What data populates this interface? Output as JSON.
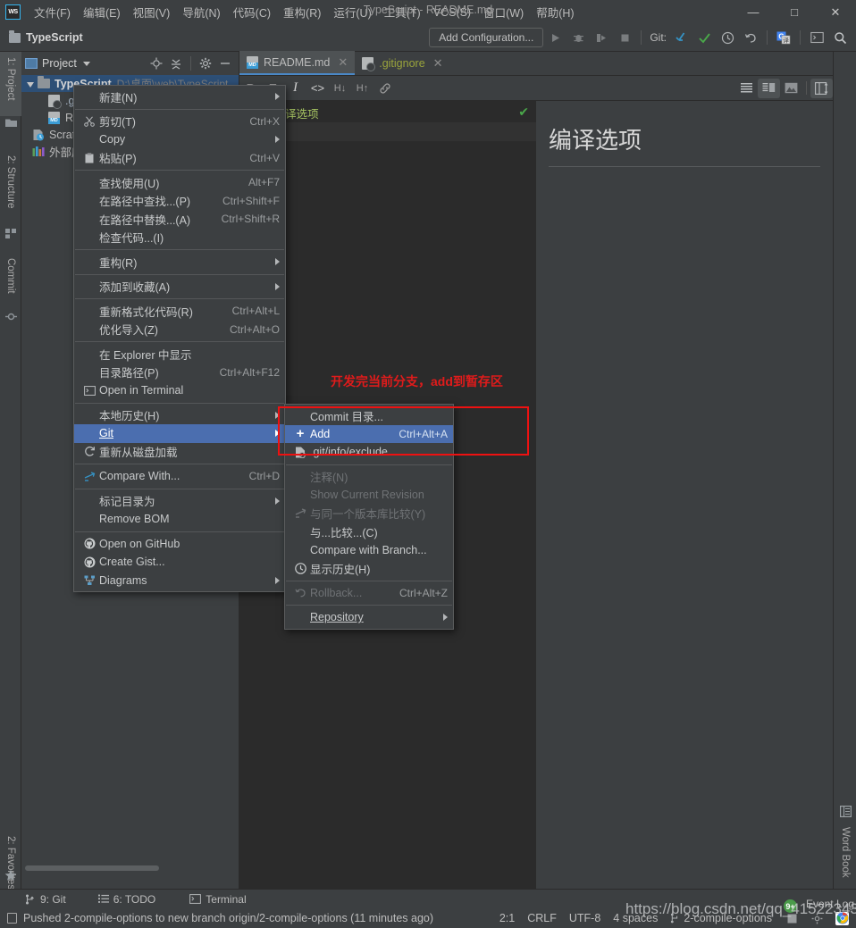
{
  "window": {
    "title": "TypeScript - README.md",
    "minimize": "—",
    "maximize": "□",
    "close": "✕"
  },
  "menubar": {
    "logo": "WS",
    "items": [
      {
        "label": "文件(F)"
      },
      {
        "label": "编辑(E)"
      },
      {
        "label": "视图(V)"
      },
      {
        "label": "导航(N)"
      },
      {
        "label": "代码(C)"
      },
      {
        "label": "重构(R)"
      },
      {
        "label": "运行(U)"
      },
      {
        "label": "工具(T)"
      },
      {
        "label": "VCS(S)"
      },
      {
        "label": "窗口(W)"
      },
      {
        "label": "帮助(H)"
      }
    ]
  },
  "toolbar": {
    "project_name": "TypeScript",
    "run_config": "Add Configuration...",
    "git_label": "Git:",
    "icons": [
      "run-icon",
      "debug-icon",
      "coverage-icon",
      "stop-icon",
      "git-update-icon",
      "git-commit-icon",
      "git-history-icon",
      "git-rollback-icon",
      "translate-icon",
      "terminal-icon",
      "search-everywhere-icon"
    ]
  },
  "left_rail": {
    "items": [
      {
        "label": "1: Project",
        "icon": "project-folder-icon",
        "selected": true
      },
      {
        "label": "2: Structure",
        "icon": "structure-icon",
        "selected": false
      },
      {
        "label": "Commit",
        "icon": "commit-icon",
        "selected": false
      },
      {
        "label": "2: Favorites",
        "icon": "star-icon",
        "selected": false
      }
    ]
  },
  "right_rail": {
    "items": [
      {
        "label": "Word Book",
        "icon": "word-book-icon"
      }
    ]
  },
  "project_panel": {
    "header": "Project",
    "header_icons": [
      "locate-icon",
      "collapse-all-icon",
      "settings-gear-icon",
      "hide-icon"
    ],
    "tree": [
      {
        "name": "TypeScript",
        "path": "D:\\桌面\\web\\TypeScript",
        "selected": true,
        "icon": "folder-icon",
        "expanded": true
      },
      {
        "name": ".gitignore",
        "icon": "gitignore-icon"
      },
      {
        "name": "README.md",
        "icon": "markdown-icon"
      },
      {
        "name": "Scratches and Consoles",
        "icon": "scratches-icon"
      },
      {
        "name": "外部库",
        "icon": "external-libraries-icon"
      }
    ]
  },
  "editor_tabs": [
    {
      "label": "README.md",
      "icon": "markdown-icon",
      "active": true,
      "close": "✕"
    },
    {
      "label": ".gitignore",
      "icon": "gitignore-icon",
      "active": false,
      "close": "✕"
    }
  ],
  "editor_toolbar": {
    "icons": [
      "bold-icon",
      "strikethrough-icon",
      "italic-icon",
      "code-icon",
      "header-down-icon",
      "header-up-icon",
      "link-icon"
    ],
    "right_icons": [
      "show-editor-only-icon",
      "show-editor-and-preview-icon",
      "show-preview-only-icon",
      "split-layout-icon"
    ]
  },
  "editor": {
    "line1_marker": "##",
    "line1_text": "编译选项",
    "inspection_ok": "✔",
    "annotation": "开发完当前分支，add到暂存区"
  },
  "preview": {
    "heading": "编译选项"
  },
  "context_menu": {
    "items": [
      {
        "label": "新建(N)",
        "icon": "",
        "shortcut": "",
        "arrow": true
      },
      {
        "sep": true
      },
      {
        "label": "剪切(T)",
        "icon": "cut-icon",
        "shortcut": "Ctrl+X"
      },
      {
        "label": "Copy",
        "icon": "",
        "shortcut": "",
        "arrow": true
      },
      {
        "label": "粘贴(P)",
        "icon": "paste-icon",
        "shortcut": "Ctrl+V"
      },
      {
        "sep": true
      },
      {
        "label": "查找使用(U)",
        "icon": "",
        "shortcut": "Alt+F7"
      },
      {
        "label": "在路径中查找...(P)",
        "icon": "",
        "shortcut": "Ctrl+Shift+F"
      },
      {
        "label": "在路径中替换...(A)",
        "icon": "",
        "shortcut": "Ctrl+Shift+R"
      },
      {
        "label": "检查代码...(I)",
        "icon": "",
        "shortcut": ""
      },
      {
        "sep": true
      },
      {
        "label": "重构(R)",
        "icon": "",
        "shortcut": "",
        "arrow": true
      },
      {
        "sep": true
      },
      {
        "label": "添加到收藏(A)",
        "icon": "",
        "shortcut": "",
        "arrow": true
      },
      {
        "sep": true
      },
      {
        "label": "重新格式化代码(R)",
        "icon": "",
        "shortcut": "Ctrl+Alt+L"
      },
      {
        "label": "优化导入(Z)",
        "icon": "",
        "shortcut": "Ctrl+Alt+O"
      },
      {
        "sep": true
      },
      {
        "label": "在 Explorer 中显示",
        "icon": "",
        "shortcut": ""
      },
      {
        "label": "目录路径(P)",
        "icon": "",
        "shortcut": "Ctrl+Alt+F12"
      },
      {
        "label": "Open in Terminal",
        "icon": "terminal-icon",
        "shortcut": ""
      },
      {
        "sep": true
      },
      {
        "label": "本地历史(H)",
        "icon": "",
        "shortcut": "",
        "arrow": true
      },
      {
        "label": "Git",
        "icon": "",
        "shortcut": "",
        "arrow": true,
        "selected": true
      },
      {
        "label": "重新从磁盘加载",
        "icon": "refresh-icon",
        "shortcut": ""
      },
      {
        "sep": true
      },
      {
        "label": "Compare With...",
        "icon": "compare-icon",
        "shortcut": "Ctrl+D"
      },
      {
        "sep": true
      },
      {
        "label": "标记目录为",
        "icon": "",
        "shortcut": "",
        "arrow": true
      },
      {
        "label": "Remove BOM",
        "icon": "",
        "shortcut": ""
      },
      {
        "sep": true
      },
      {
        "label": "Open on GitHub",
        "icon": "github-icon",
        "shortcut": ""
      },
      {
        "label": "Create Gist...",
        "icon": "github-icon",
        "shortcut": ""
      },
      {
        "label": "Diagrams",
        "icon": "diagrams-icon",
        "shortcut": "",
        "arrow": true
      }
    ]
  },
  "git_submenu": {
    "items": [
      {
        "label": "Commit 目录...",
        "icon": "",
        "shortcut": ""
      },
      {
        "label": "Add",
        "icon": "add-plus-icon",
        "shortcut": "Ctrl+Alt+A",
        "selected": true
      },
      {
        "label": ".git/info/exclude",
        "icon": "gitignore-icon",
        "shortcut": ""
      },
      {
        "sep": true
      },
      {
        "label": "注释(N)",
        "icon": "",
        "shortcut": "",
        "disabled": true
      },
      {
        "label": "Show Current Revision",
        "icon": "",
        "shortcut": "",
        "disabled": true
      },
      {
        "label": "与同一个版本库比较(Y)",
        "icon": "compare-icon",
        "shortcut": "",
        "disabled": true
      },
      {
        "label": "与...比较...(C)",
        "icon": "",
        "shortcut": ""
      },
      {
        "label": "Compare with Branch...",
        "icon": "",
        "shortcut": ""
      },
      {
        "label": "显示历史(H)",
        "icon": "history-clock-icon",
        "shortcut": ""
      },
      {
        "sep": true
      },
      {
        "label": "Rollback...",
        "icon": "rollback-icon",
        "shortcut": "Ctrl+Alt+Z",
        "disabled": true
      },
      {
        "sep": true
      },
      {
        "label": "Repository",
        "icon": "",
        "shortcut": "",
        "arrow": true
      }
    ]
  },
  "bottom_bar": {
    "items": [
      {
        "label": "9: Git",
        "icon": "git-branch-icon"
      },
      {
        "label": "6: TODO",
        "icon": "todo-list-icon"
      },
      {
        "label": "Terminal",
        "icon": "terminal-icon"
      }
    ]
  },
  "status_bar": {
    "message": "Pushed 2-compile-options to new branch origin/2-compile-options (11 minutes ago)",
    "caret": "2:1",
    "line_sep": "CRLF",
    "encoding": "UTF-8",
    "indent": "4 spaces",
    "branch": "2-compile-options",
    "event_log": "Event Log",
    "event_count": "9+"
  },
  "watermark": {
    "text": "https://blog.csdn.net/qq_41522343"
  },
  "colors": {
    "bg": "#3c3f41",
    "editor_bg": "#2b2b2b",
    "accent_blue": "#4b6eaf",
    "tree_select": "#2d4f76",
    "red_highlight": "#ee1111",
    "annotation_red": "#e01b1b",
    "md_header": "#cc7832",
    "md_text": "#a5c261",
    "green_check": "#4aa84a"
  }
}
